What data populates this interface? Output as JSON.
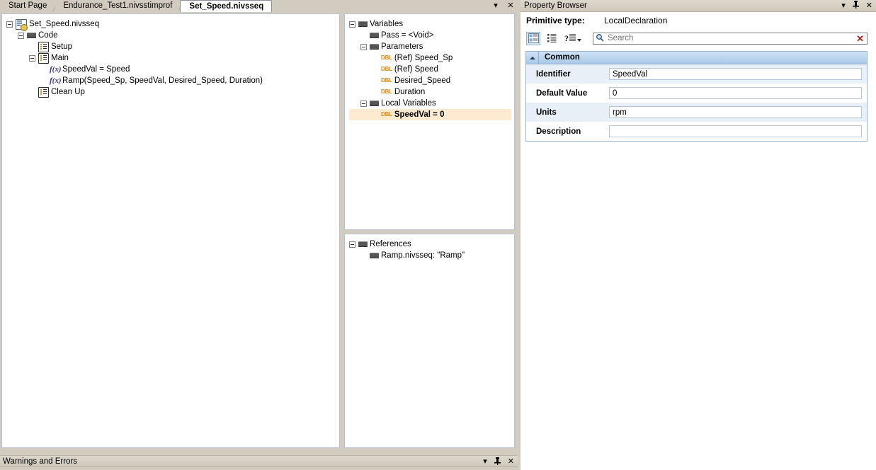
{
  "document_tabs": {
    "tabs": [
      {
        "label": "Start Page",
        "active": false
      },
      {
        "label": "Endurance_Test1.nivsstimprof",
        "active": false
      },
      {
        "label": "Set_Speed.nivsseq",
        "active": true
      }
    ],
    "dropdown_icon": "▾",
    "close_icon": "✕"
  },
  "sequence_tree": {
    "nodes": [
      {
        "label": "Set_Speed.nivsseq",
        "icon": "sequence-document-icon",
        "depth": 0,
        "toggle": "minus"
      },
      {
        "label": "Code",
        "icon": "folder-icon",
        "depth": 1,
        "toggle": "minus"
      },
      {
        "label": "Setup",
        "icon": "step-group-icon",
        "depth": 2,
        "toggle": "none"
      },
      {
        "label": "Main",
        "icon": "step-group-icon",
        "depth": 2,
        "toggle": "minus"
      },
      {
        "label": "SpeedVal = Speed",
        "icon": "function-icon",
        "depth": 3,
        "toggle": "none"
      },
      {
        "label": "Ramp(Speed_Sp, SpeedVal, Desired_Speed, Duration)",
        "icon": "function-icon",
        "depth": 3,
        "toggle": "none"
      },
      {
        "label": "Clean Up",
        "icon": "step-group-icon",
        "depth": 2,
        "toggle": "none"
      }
    ]
  },
  "variables_panel": {
    "nodes": [
      {
        "label": "Variables",
        "icon": "folder-icon",
        "depth": 0,
        "toggle": "minus",
        "selected": false
      },
      {
        "label": "Pass = <Void>",
        "icon": "folder-icon",
        "depth": 1,
        "toggle": "none",
        "selected": false
      },
      {
        "label": "Parameters",
        "icon": "folder-icon",
        "depth": 1,
        "toggle": "minus",
        "selected": false
      },
      {
        "label": "(Ref) Speed_Sp",
        "icon": "dbl-type-icon",
        "badge": "DBL",
        "depth": 2,
        "toggle": "none",
        "selected": false
      },
      {
        "label": "(Ref) Speed",
        "icon": "dbl-type-icon",
        "badge": "DBL",
        "depth": 2,
        "toggle": "none",
        "selected": false
      },
      {
        "label": "Desired_Speed",
        "icon": "dbl-type-icon",
        "badge": "DBL",
        "depth": 2,
        "toggle": "none",
        "selected": false
      },
      {
        "label": "Duration",
        "icon": "dbl-type-icon",
        "badge": "DBL",
        "depth": 2,
        "toggle": "none",
        "selected": false
      },
      {
        "label": "Local Variables",
        "icon": "folder-icon",
        "depth": 1,
        "toggle": "minus",
        "selected": false
      },
      {
        "label": "SpeedVal = 0",
        "icon": "dbl-type-icon",
        "badge": "DBL",
        "depth": 2,
        "toggle": "none",
        "selected": true
      }
    ]
  },
  "references_panel": {
    "nodes": [
      {
        "label": "References",
        "icon": "folder-icon",
        "depth": 0,
        "toggle": "minus"
      },
      {
        "label": "Ramp.nivsseq: \"Ramp\"",
        "icon": "folder-icon",
        "depth": 1,
        "toggle": "none"
      }
    ]
  },
  "property_browser": {
    "title": "Property Browser",
    "dropdown_icon": "▾",
    "pin_icon": "⇱",
    "close_icon": "✕",
    "primitive_type_label": "Primitive type:",
    "primitive_type_value": "LocalDeclaration",
    "toolbar": {
      "categorized_label": "categorized-view-icon",
      "alphabetical_label": "alphabetical-view-icon",
      "help_label": "property-pages-icon",
      "caret": "▾"
    },
    "search": {
      "placeholder": "Search",
      "value": "",
      "clear_icon": "✕"
    },
    "group": {
      "title": "Common",
      "collapse_icon": "▴"
    },
    "rows": [
      {
        "label": "Identifier",
        "value": "SpeedVal"
      },
      {
        "label": "Default Value",
        "value": "0"
      },
      {
        "label": "Units",
        "value": "rpm"
      },
      {
        "label": "Description",
        "value": ""
      }
    ]
  },
  "warnings_panel": {
    "title": "Warnings and Errors",
    "dropdown_icon": "▾",
    "pin_icon": "⇱",
    "close_icon": "✕"
  },
  "colors": {
    "accent_blue": "#a9c9e8",
    "type_orange": "#e08a18",
    "selection": "#fdead1",
    "chrome": "#d2ccc0"
  }
}
